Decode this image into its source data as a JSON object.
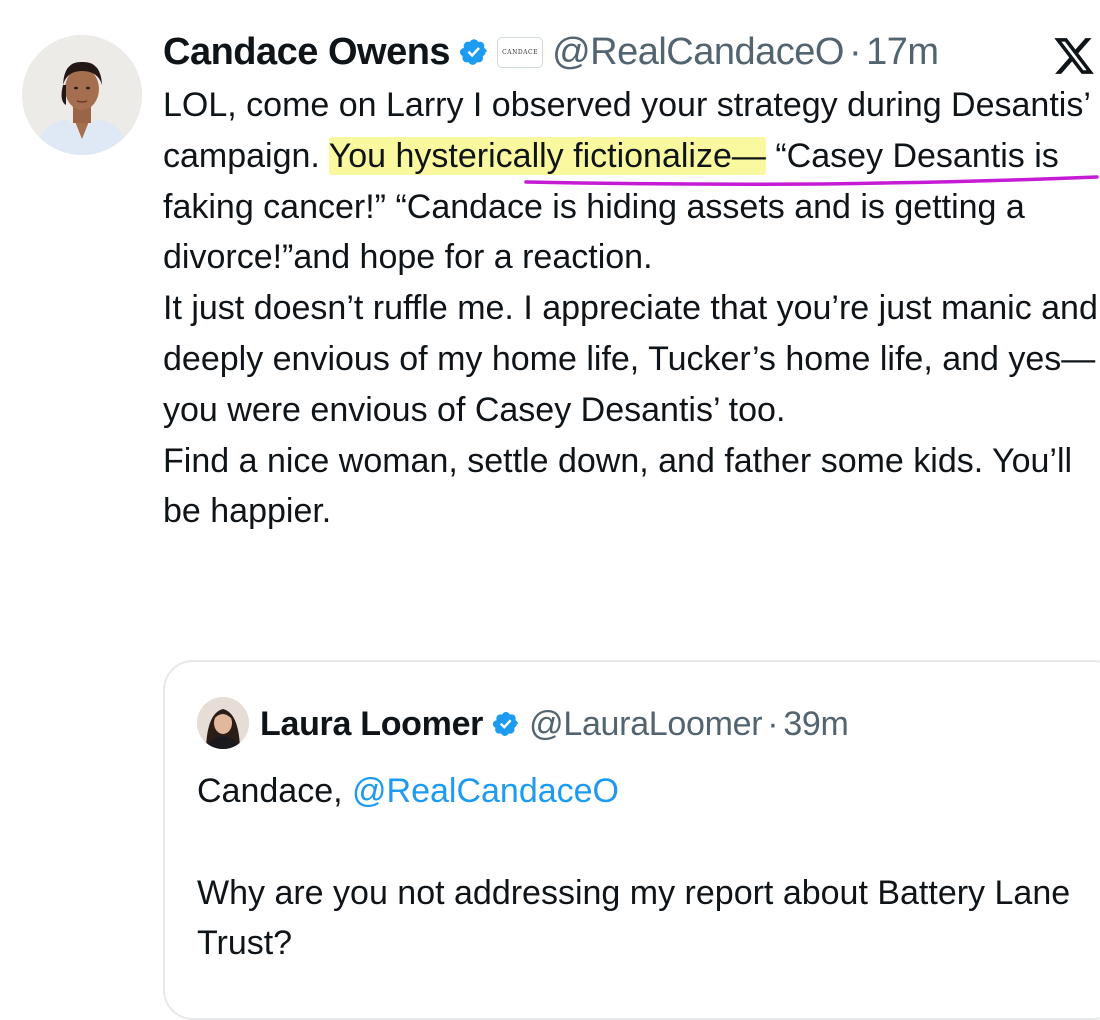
{
  "tweet": {
    "author_name": "Candace Owens",
    "affiliate_badge_text": "CANDACE",
    "handle": "@RealCandaceO",
    "separator": "·",
    "time": "17m",
    "text": {
      "p1_before": "LOL, come on Larry I observed your strategy during Desantis’ campaign. ",
      "p1_highlight": "You hysterically fictionalize—",
      "p1_after": " “Casey Desantis is faking cancer!” “Candace is hiding assets and is getting a divorce!”and hope for a reaction.",
      "p2": "It just doesn’t ruffle me. I appreciate that you’re just manic and deeply envious of my home life, Tucker’s home life, and yes—you were envious of Casey Desantis’ too.",
      "p3": "Find a nice woman, settle down, and father some kids. You’ll be happier."
    }
  },
  "quoted_tweet": {
    "author_name": "Laura Loomer",
    "handle": "@LauraLoomer",
    "separator": "·",
    "time": "39m",
    "text_before": "Candace, ",
    "mention": "@RealCandaceO",
    "text_after": "Why are you not addressing my report about Battery Lane Trust?"
  },
  "icons": {
    "verified": "verified-badge-icon",
    "platform": "x-logo-icon"
  },
  "colors": {
    "text": "#0f1419",
    "secondary": "#536471",
    "link": "#1d9bf0",
    "verified": "#1d9bf0",
    "highlight": "#fbf9a0",
    "pen_underline": "#c51bd4"
  }
}
